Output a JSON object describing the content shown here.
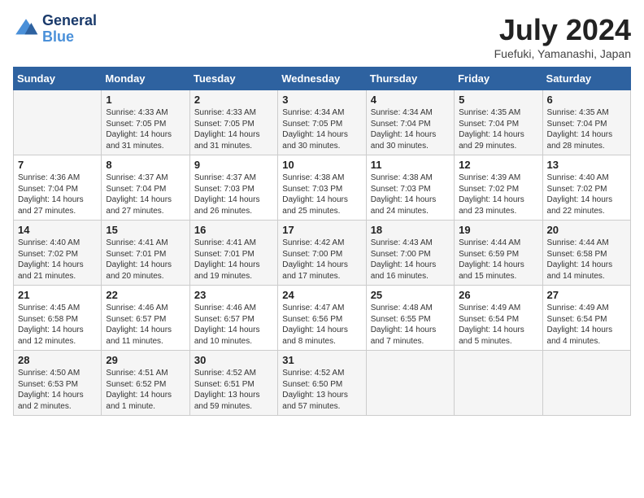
{
  "logo": {
    "line1": "General",
    "line2": "Blue"
  },
  "title": "July 2024",
  "subtitle": "Fuefuki, Yamanashi, Japan",
  "headers": [
    "Sunday",
    "Monday",
    "Tuesday",
    "Wednesday",
    "Thursday",
    "Friday",
    "Saturday"
  ],
  "weeks": [
    [
      {
        "day": "",
        "info": ""
      },
      {
        "day": "1",
        "info": "Sunrise: 4:33 AM\nSunset: 7:05 PM\nDaylight: 14 hours\nand 31 minutes."
      },
      {
        "day": "2",
        "info": "Sunrise: 4:33 AM\nSunset: 7:05 PM\nDaylight: 14 hours\nand 31 minutes."
      },
      {
        "day": "3",
        "info": "Sunrise: 4:34 AM\nSunset: 7:05 PM\nDaylight: 14 hours\nand 30 minutes."
      },
      {
        "day": "4",
        "info": "Sunrise: 4:34 AM\nSunset: 7:04 PM\nDaylight: 14 hours\nand 30 minutes."
      },
      {
        "day": "5",
        "info": "Sunrise: 4:35 AM\nSunset: 7:04 PM\nDaylight: 14 hours\nand 29 minutes."
      },
      {
        "day": "6",
        "info": "Sunrise: 4:35 AM\nSunset: 7:04 PM\nDaylight: 14 hours\nand 28 minutes."
      }
    ],
    [
      {
        "day": "7",
        "info": "Sunrise: 4:36 AM\nSunset: 7:04 PM\nDaylight: 14 hours\nand 27 minutes."
      },
      {
        "day": "8",
        "info": "Sunrise: 4:37 AM\nSunset: 7:04 PM\nDaylight: 14 hours\nand 27 minutes."
      },
      {
        "day": "9",
        "info": "Sunrise: 4:37 AM\nSunset: 7:03 PM\nDaylight: 14 hours\nand 26 minutes."
      },
      {
        "day": "10",
        "info": "Sunrise: 4:38 AM\nSunset: 7:03 PM\nDaylight: 14 hours\nand 25 minutes."
      },
      {
        "day": "11",
        "info": "Sunrise: 4:38 AM\nSunset: 7:03 PM\nDaylight: 14 hours\nand 24 minutes."
      },
      {
        "day": "12",
        "info": "Sunrise: 4:39 AM\nSunset: 7:02 PM\nDaylight: 14 hours\nand 23 minutes."
      },
      {
        "day": "13",
        "info": "Sunrise: 4:40 AM\nSunset: 7:02 PM\nDaylight: 14 hours\nand 22 minutes."
      }
    ],
    [
      {
        "day": "14",
        "info": "Sunrise: 4:40 AM\nSunset: 7:02 PM\nDaylight: 14 hours\nand 21 minutes."
      },
      {
        "day": "15",
        "info": "Sunrise: 4:41 AM\nSunset: 7:01 PM\nDaylight: 14 hours\nand 20 minutes."
      },
      {
        "day": "16",
        "info": "Sunrise: 4:41 AM\nSunset: 7:01 PM\nDaylight: 14 hours\nand 19 minutes."
      },
      {
        "day": "17",
        "info": "Sunrise: 4:42 AM\nSunset: 7:00 PM\nDaylight: 14 hours\nand 17 minutes."
      },
      {
        "day": "18",
        "info": "Sunrise: 4:43 AM\nSunset: 7:00 PM\nDaylight: 14 hours\nand 16 minutes."
      },
      {
        "day": "19",
        "info": "Sunrise: 4:44 AM\nSunset: 6:59 PM\nDaylight: 14 hours\nand 15 minutes."
      },
      {
        "day": "20",
        "info": "Sunrise: 4:44 AM\nSunset: 6:58 PM\nDaylight: 14 hours\nand 14 minutes."
      }
    ],
    [
      {
        "day": "21",
        "info": "Sunrise: 4:45 AM\nSunset: 6:58 PM\nDaylight: 14 hours\nand 12 minutes."
      },
      {
        "day": "22",
        "info": "Sunrise: 4:46 AM\nSunset: 6:57 PM\nDaylight: 14 hours\nand 11 minutes."
      },
      {
        "day": "23",
        "info": "Sunrise: 4:46 AM\nSunset: 6:57 PM\nDaylight: 14 hours\nand 10 minutes."
      },
      {
        "day": "24",
        "info": "Sunrise: 4:47 AM\nSunset: 6:56 PM\nDaylight: 14 hours\nand 8 minutes."
      },
      {
        "day": "25",
        "info": "Sunrise: 4:48 AM\nSunset: 6:55 PM\nDaylight: 14 hours\nand 7 minutes."
      },
      {
        "day": "26",
        "info": "Sunrise: 4:49 AM\nSunset: 6:54 PM\nDaylight: 14 hours\nand 5 minutes."
      },
      {
        "day": "27",
        "info": "Sunrise: 4:49 AM\nSunset: 6:54 PM\nDaylight: 14 hours\nand 4 minutes."
      }
    ],
    [
      {
        "day": "28",
        "info": "Sunrise: 4:50 AM\nSunset: 6:53 PM\nDaylight: 14 hours\nand 2 minutes."
      },
      {
        "day": "29",
        "info": "Sunrise: 4:51 AM\nSunset: 6:52 PM\nDaylight: 14 hours\nand 1 minute."
      },
      {
        "day": "30",
        "info": "Sunrise: 4:52 AM\nSunset: 6:51 PM\nDaylight: 13 hours\nand 59 minutes."
      },
      {
        "day": "31",
        "info": "Sunrise: 4:52 AM\nSunset: 6:50 PM\nDaylight: 13 hours\nand 57 minutes."
      },
      {
        "day": "",
        "info": ""
      },
      {
        "day": "",
        "info": ""
      },
      {
        "day": "",
        "info": ""
      }
    ]
  ]
}
